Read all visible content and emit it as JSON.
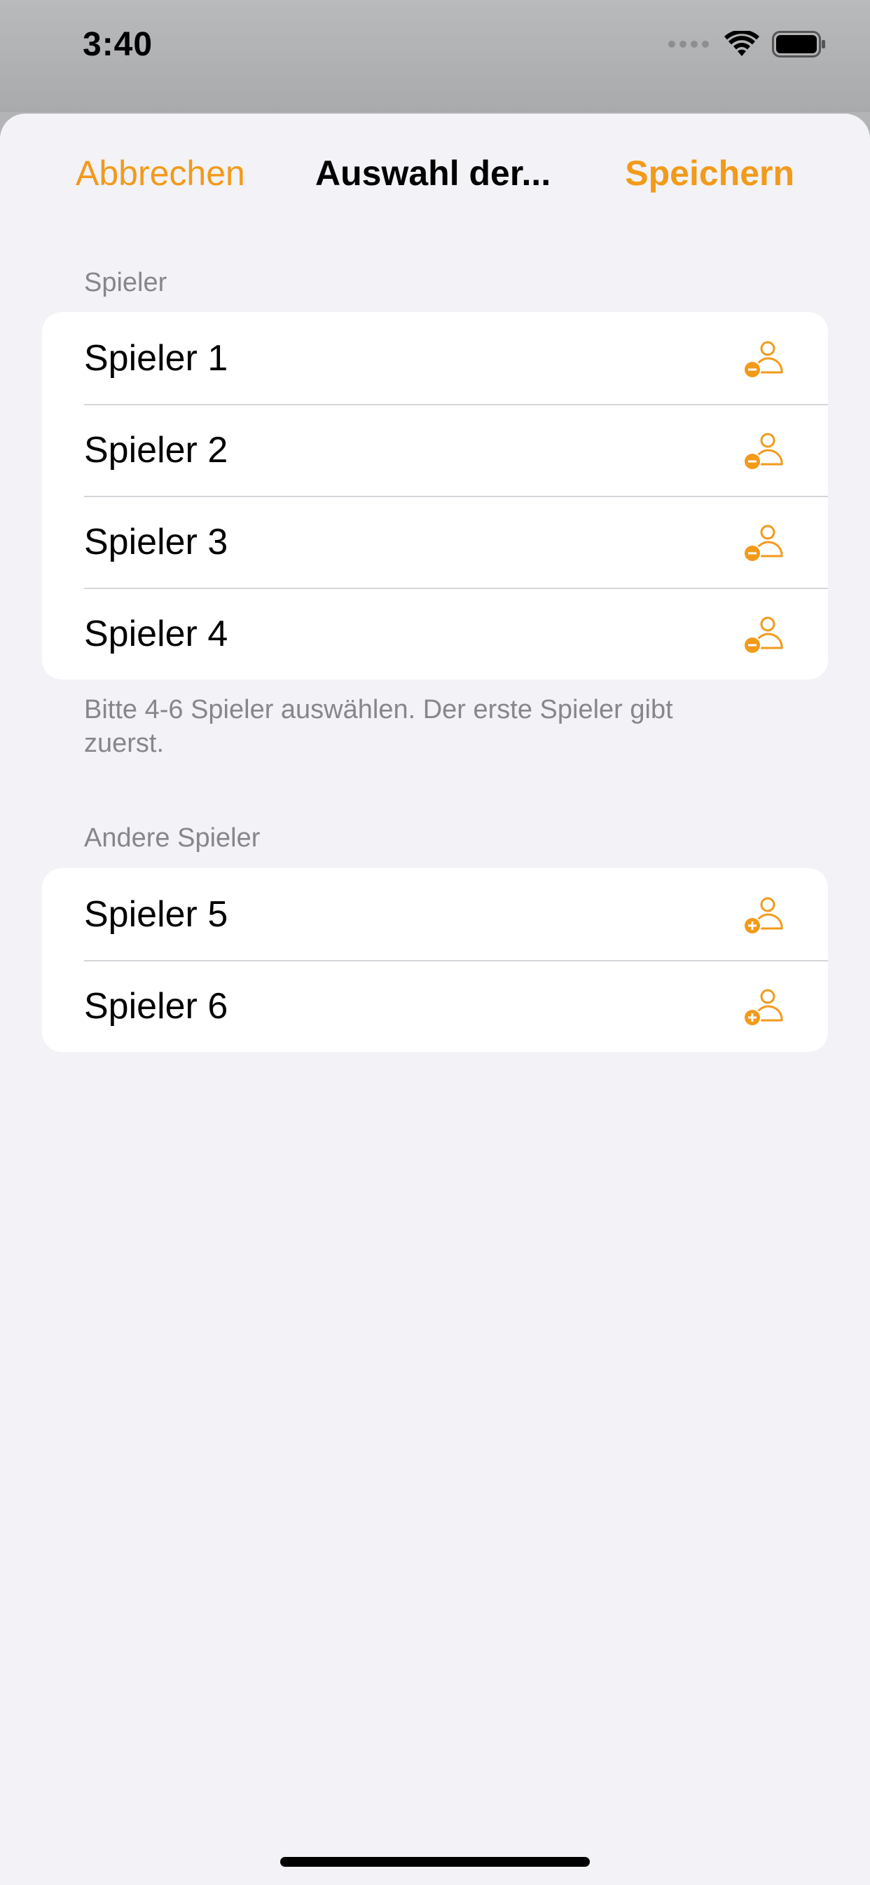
{
  "status": {
    "time": "3:40"
  },
  "nav": {
    "cancel_label": "Abbrechen",
    "title": "Auswahl der...",
    "save_label": "Speichern"
  },
  "selected": {
    "header": "Spieler",
    "players": [
      "Spieler 1",
      "Spieler 2",
      "Spieler 3",
      "Spieler 4"
    ],
    "footer": "Bitte 4-6 Spieler auswählen. Der erste Spieler gibt zuerst."
  },
  "others": {
    "header": "Andere Spieler",
    "players": [
      "Spieler 5",
      "Spieler 6"
    ]
  },
  "icons": {
    "remove": "person-remove-icon",
    "add": "person-add-icon"
  },
  "colors": {
    "accent": "#f29a1a",
    "background": "#f2f2f7"
  }
}
